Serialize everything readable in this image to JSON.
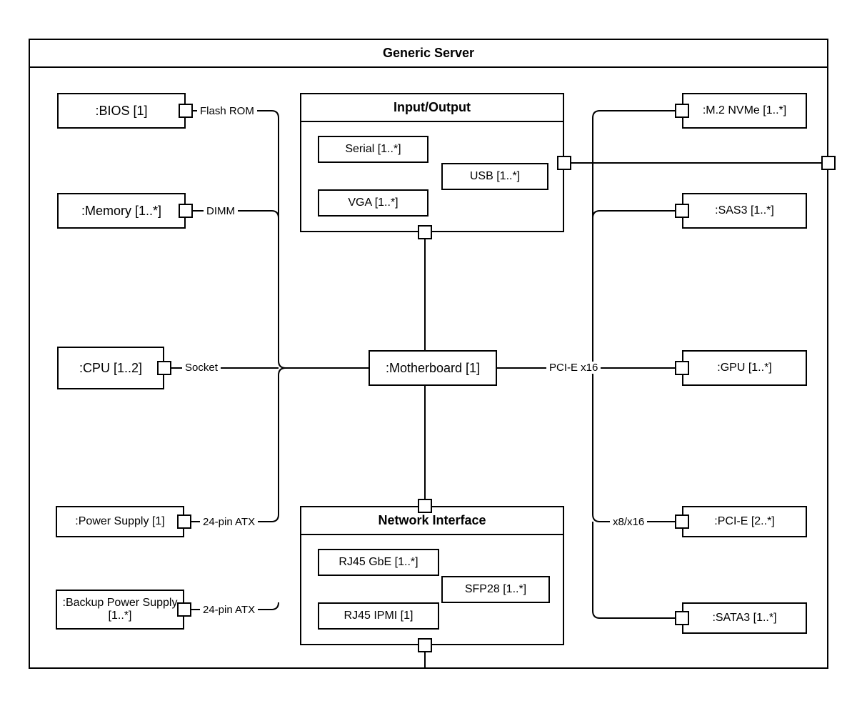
{
  "diagram": {
    "title": "Generic Server",
    "components": {
      "bios": {
        "label": ":BIOS [1]"
      },
      "memory": {
        "label": ":Memory [1..*]"
      },
      "cpu": {
        "label": ":CPU [1..2]"
      },
      "psu": {
        "label": ":Power Supply [1]"
      },
      "backup_psu": {
        "label": ":Backup Power Supply [1..*]"
      },
      "motherboard": {
        "label": ":Motherboard [1]"
      },
      "m2": {
        "label": ":M.2 NVMe [1..*]"
      },
      "sas3": {
        "label": ":SAS3 [1..*]"
      },
      "gpu": {
        "label": ":GPU [1..*]"
      },
      "pcie": {
        "label": ":PCI-E [2..*]"
      },
      "sata3": {
        "label": ":SATA3 [1..*]"
      }
    },
    "composites": {
      "io": {
        "title": "Input/Output",
        "parts": {
          "serial": {
            "label": "Serial [1..*]"
          },
          "usb": {
            "label": "USB [1..*]"
          },
          "vga": {
            "label": "VGA [1..*]"
          }
        }
      },
      "net": {
        "title": "Network Interface",
        "parts": {
          "rj45_gbe": {
            "label": "RJ45 GbE [1..*]"
          },
          "sfp28": {
            "label": "SFP28 [1..*]"
          },
          "rj45_ipmi": {
            "label": "RJ45 IPMI [1]"
          }
        }
      }
    },
    "edges": {
      "flash_rom": {
        "label": "Flash ROM"
      },
      "dimm": {
        "label": "DIMM"
      },
      "socket": {
        "label": "Socket"
      },
      "atx1": {
        "label": "24-pin ATX"
      },
      "atx2": {
        "label": "24-pin ATX"
      },
      "pcie_x16": {
        "label": "PCI-E x16"
      },
      "x8x16": {
        "label": "x8/x16"
      }
    }
  }
}
